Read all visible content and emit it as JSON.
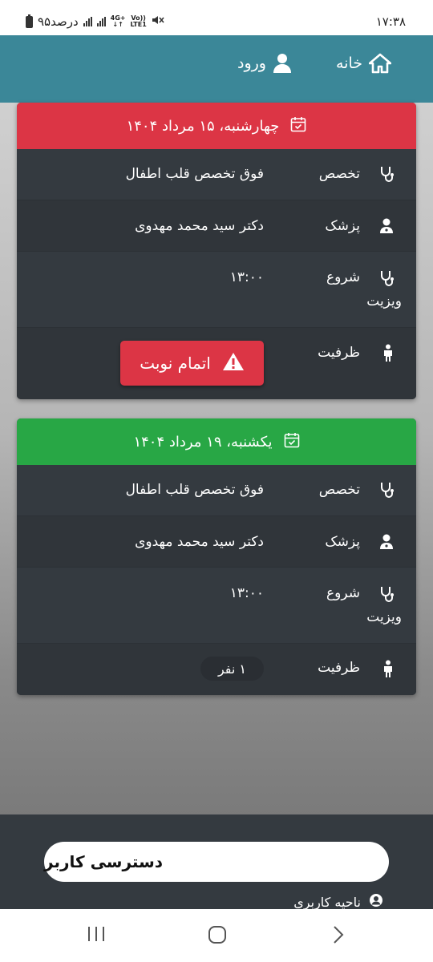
{
  "status_bar": {
    "time": "۱۷:۳۸",
    "battery_text": "۹۵درصد",
    "network_top": "4G+",
    "network_bottom": "LTE1",
    "volte": "Vo))"
  },
  "header": {
    "home_label": "خانه",
    "login_label": "ورود"
  },
  "appointments": [
    {
      "date": "چهارشنبه، ۱۵ مرداد ۱۴۰۴",
      "header_color": "#dc3545",
      "specialty_label": "تخصص",
      "specialty_value": "فوق تخصص قلب اطفال",
      "doctor_label": "پزشک",
      "doctor_value": "دکتر سید محمد مهدوی",
      "start_label_line1": "شروع",
      "start_label_line2": "ویزیت",
      "start_value": "۱۳:۰۰",
      "capacity_label": "ظرفیت",
      "capacity_status": "اتمام نوبت"
    },
    {
      "date": "یکشنبه، ۱۹ مرداد ۱۴۰۴",
      "header_color": "#28a745",
      "specialty_label": "تخصص",
      "specialty_value": "فوق تخصص قلب اطفال",
      "doctor_label": "پزشک",
      "doctor_value": "دکتر سید محمد مهدوی",
      "start_label_line1": "شروع",
      "start_label_line2": "ویزیت",
      "start_value": "۱۳:۰۰",
      "capacity_label": "ظرفیت",
      "capacity_value": "۱ نفر"
    }
  ],
  "footer": {
    "user_access_title": "دسترسی کاربر",
    "user_area_label": "ناحیه کاربری"
  },
  "colors": {
    "header_bg": "#3b8798",
    "card_bg": "#343a40",
    "danger": "#dc3545",
    "success": "#28a745"
  }
}
